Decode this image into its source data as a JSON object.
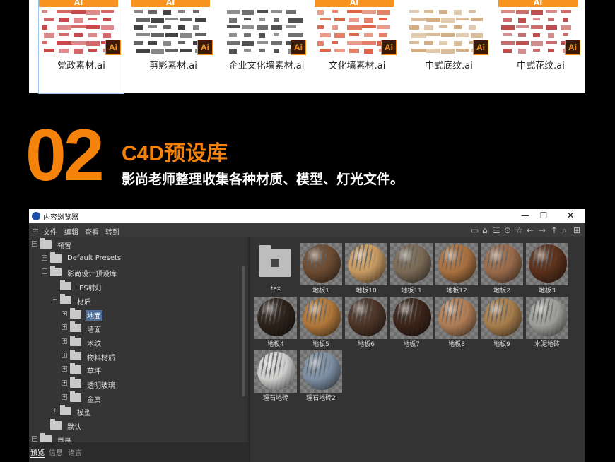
{
  "files": [
    {
      "name": "党政素材.ai",
      "badge": "AI",
      "ai": "Ai",
      "selected": true
    },
    {
      "name": "剪影素材.ai",
      "badge": "AI",
      "ai": "Ai",
      "selected": false
    },
    {
      "name": "企业文化墙素材.ai",
      "badge": "",
      "ai": "Ai",
      "selected": false
    },
    {
      "name": "文化墙素材.ai",
      "badge": "AI",
      "ai": "Ai",
      "selected": false
    },
    {
      "name": "中式底纹.ai",
      "badge": "",
      "ai": "Ai",
      "selected": false
    },
    {
      "name": "中式花纹.ai",
      "badge": "AI",
      "ai": "Ai",
      "selected": false
    }
  ],
  "section": {
    "number": "02",
    "title": "C4D预设库",
    "subtitle": "影尚老师整理收集各种材质、模型、灯光文件。"
  },
  "window": {
    "title": "内容浏览器",
    "controls": {
      "minimize": "—",
      "maximize": "☐",
      "close": "✕"
    },
    "menu": [
      "文件",
      "编辑",
      "查看",
      "转到"
    ],
    "toolbar_icons": [
      "view-mode-icon",
      "home-icon",
      "filter-icon",
      "path-icon",
      "star-icon",
      "back-icon",
      "forward-icon",
      "up-icon",
      "search-icon",
      "new-icon"
    ],
    "tree": [
      {
        "label": "预置",
        "expander": "−"
      },
      {
        "label": "Default Presets",
        "expander": "+"
      },
      {
        "label": "影尚设计预设库",
        "expander": "−"
      },
      {
        "label": "IES射灯",
        "expander": ""
      },
      {
        "label": "材质",
        "expander": "−"
      },
      {
        "label": "地面",
        "expander": "+",
        "selected": true
      },
      {
        "label": "墙面",
        "expander": "+"
      },
      {
        "label": "木纹",
        "expander": "+"
      },
      {
        "label": "物料材质",
        "expander": "+"
      },
      {
        "label": "草坪",
        "expander": "+"
      },
      {
        "label": "透明玻璃",
        "expander": "+"
      },
      {
        "label": "金属",
        "expander": "+"
      },
      {
        "label": "模型",
        "expander": "+"
      },
      {
        "label": "默认",
        "expander": ""
      },
      {
        "label": "目录",
        "expander": "−"
      }
    ],
    "bottom_tabs": [
      "预览",
      "信息",
      "语言"
    ],
    "items": [
      {
        "label": "tex",
        "kind": "folder",
        "color": "#bdbdbd"
      },
      {
        "label": "地板1",
        "kind": "material",
        "color": "#6b4a30"
      },
      {
        "label": "地板10",
        "kind": "material",
        "color": "#c79a62"
      },
      {
        "label": "地板11",
        "kind": "material",
        "color": "#7a6a55"
      },
      {
        "label": "地板12",
        "kind": "material",
        "color": "#a8703f"
      },
      {
        "label": "地板2",
        "kind": "material",
        "color": "#9a6b4b"
      },
      {
        "label": "地板3",
        "kind": "material",
        "color": "#5a2f1a"
      },
      {
        "label": "地板4",
        "kind": "material",
        "color": "#2c2219"
      },
      {
        "label": "地板5",
        "kind": "material",
        "color": "#b0773a"
      },
      {
        "label": "地板6",
        "kind": "material",
        "color": "#4b3325"
      },
      {
        "label": "地板7",
        "kind": "material",
        "color": "#3a2318"
      },
      {
        "label": "地板8",
        "kind": "material",
        "color": "#b07d55"
      },
      {
        "label": "地板9",
        "kind": "material",
        "color": "#a77d4c"
      },
      {
        "label": "水泥地砖",
        "kind": "material",
        "color": "#9e9e9a"
      },
      {
        "label": "理石地砖",
        "kind": "material",
        "color": "#cfd0ce"
      },
      {
        "label": "理石地砖2",
        "kind": "material",
        "color": "#7d8fa4"
      }
    ]
  }
}
